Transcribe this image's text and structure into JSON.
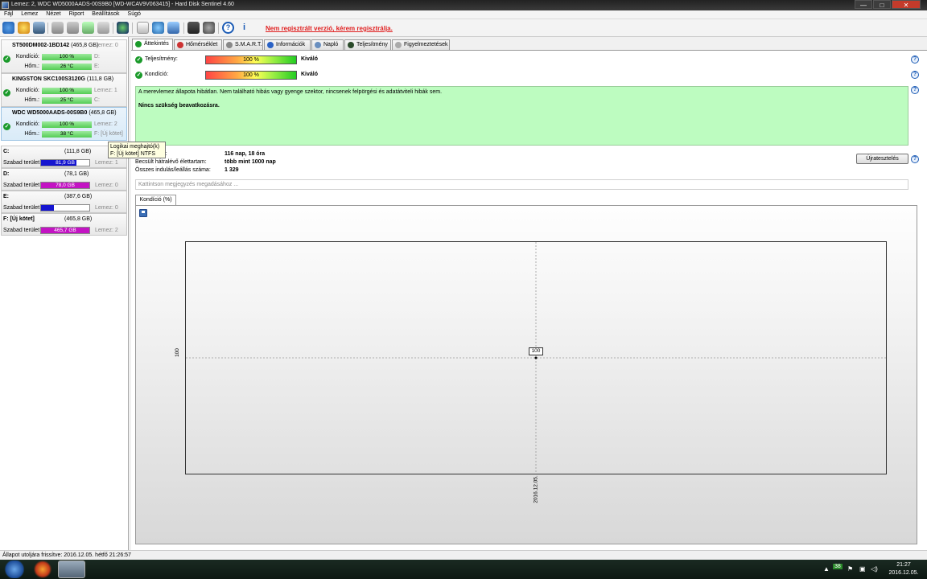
{
  "window": {
    "title": "Lemez: 2, WDC WD5000AADS-00S9B0 [WD-WCAV9V063415]  -  Hard Disk Sentinel 4.60",
    "minimize": "—",
    "maximize": "□",
    "close": "✕"
  },
  "menu": [
    "Fájl",
    "Lemez",
    "Nézet",
    "Riport",
    "Beállítások",
    "Súgó"
  ],
  "toolbar": {
    "registration_warning": "Nem regisztrált verzió, kérem regisztrálja."
  },
  "disks": [
    {
      "name": "ST500DM002-1BD142",
      "size": "(465,8 GB)",
      "disk_no": "Lemez: 0",
      "condition_label": "Kondíció:",
      "condition": "100 %",
      "temp_label": "Hőm.:",
      "temp": "26 °C",
      "vol1": "D:",
      "vol2": "E:"
    },
    {
      "name": "KINGSTON SKC100S3120G",
      "size": "(111,8 GB)",
      "disk_no": "Lemez: 1",
      "condition_label": "Kondíció:",
      "condition": "100 %",
      "temp_label": "Hőm.:",
      "temp": "25 °C",
      "vol1": "C:",
      "vol2": ""
    },
    {
      "name": "WDC WD5000AADS-00S9B0",
      "size": "(465,8 GB)",
      "disk_no": "Lemez: 2",
      "condition_label": "Kondíció:",
      "condition": "100 %",
      "temp_label": "Hőm.:",
      "temp": "38 °C",
      "vol1": "F: [Új kötet]",
      "vol2": ""
    }
  ],
  "volumes": [
    {
      "name": "C:",
      "size": "(111,8 GB)",
      "free_label": "Szabad terület",
      "free": "81,9 GB",
      "disk": "Lemez: 1",
      "color": "#1515d0",
      "fill": 0.73
    },
    {
      "name": "D:",
      "size": "(78,1 GB)",
      "free_label": "Szabad terület",
      "free": "78,0 GB",
      "disk": "Lemez: 0",
      "color": "#c313c3",
      "fill": 1.0
    },
    {
      "name": "E:",
      "size": "(387,6 GB)",
      "free_label": "Szabad terület",
      "free": "105,0 GB",
      "disk": "Lemez: 0",
      "color": "#1515d0",
      "fill": 0.27
    },
    {
      "name": "F: [Új kötet]",
      "size": "(465,8 GB)",
      "free_label": "Szabad terület",
      "free": "465,7 GB",
      "disk": "Lemez: 2",
      "color": "#c313c3",
      "fill": 1.0
    }
  ],
  "tooltip": {
    "line1": "Logikai meghajtó(k)",
    "line2": "F: [Új kötet] NTFS"
  },
  "tabs": [
    {
      "label": "Áttekintés",
      "icon": "check-icon",
      "color": "#1a9a2a"
    },
    {
      "label": "Hőmérséklet",
      "icon": "thermometer-icon",
      "color": "#c33"
    },
    {
      "label": "S.M.A.R.T.",
      "icon": "smart-icon",
      "color": "#888"
    },
    {
      "label": "Információk",
      "icon": "info-icon",
      "color": "#2a62c5"
    },
    {
      "label": "Napló",
      "icon": "log-icon",
      "color": "#6a8fbf"
    },
    {
      "label": "Teljesítmény",
      "icon": "performance-icon",
      "color": "#2a4a2a"
    },
    {
      "label": "Figyelmeztetések",
      "icon": "alerts-icon",
      "color": "#aaa"
    }
  ],
  "overview": {
    "performance_label": "Teljesítmény:",
    "performance_value": "100 %",
    "performance_rating": "Kiváló",
    "condition_label": "Kondíció:",
    "condition_value": "100 %",
    "condition_rating": "Kiváló",
    "status_text": "A merevlemez állapota hibátlan. Nem található hibás vagy gyenge szektor, nincsenek felpörgési és adatátviteli hibák sem.",
    "status_advice": "Nincs szükség beavatkozásra.",
    "power_on_label": "dó:",
    "power_on_value": "116 nap, 18 óra",
    "lifetime_label": "Becsült hátralévő élettartam:",
    "lifetime_value": "több mint 1000 nap",
    "starts_label": "Összes indulás/leállás száma:",
    "starts_value": "1 329",
    "retest_button": "Újratesztelés",
    "note_placeholder": "Kattintson megjegyzés megadásához ..."
  },
  "chart_tab": "Kondíció  (%)",
  "chart_data": {
    "type": "line",
    "title": "",
    "x": [
      "2016.12.05."
    ],
    "series": [
      {
        "values": [
          100
        ]
      }
    ],
    "xlabel": "",
    "ylabel": "",
    "ytick": "100",
    "xtick": "2016.12.05.",
    "data_label": "100",
    "grid": true
  },
  "statusbar": {
    "text": "Állapot utoljára frissítve: 2016.12.05. hétfő 21:26:57"
  },
  "taskbar": {
    "time": "21:27",
    "date": "2016.12.05.",
    "tray_badge": "38"
  }
}
